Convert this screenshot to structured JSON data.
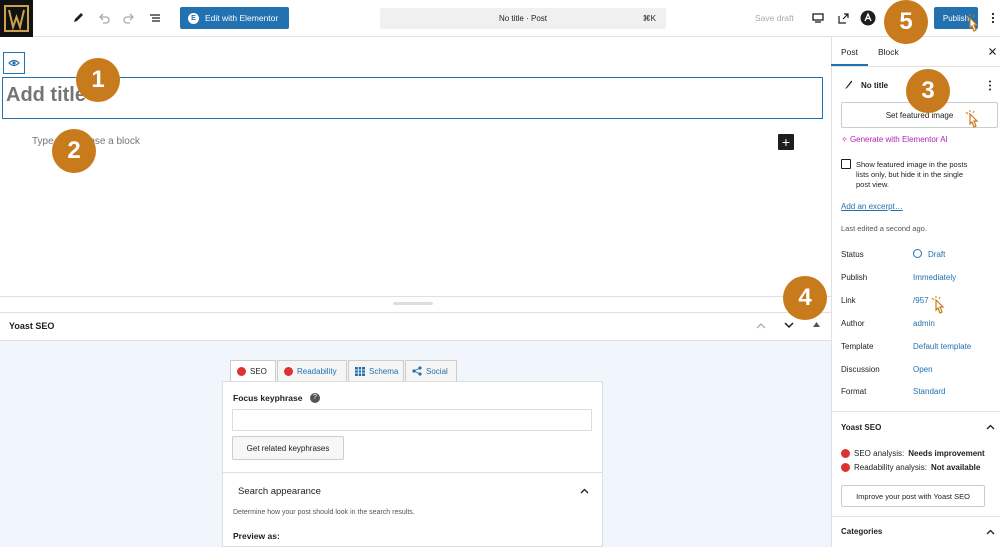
{
  "topbar": {
    "edit_elementor_label": "Edit with Elementor",
    "command_title": "No title · Post",
    "command_shortcut": "⌘K",
    "save_draft_label": "Save draft",
    "publish_label": "Publish"
  },
  "editor": {
    "title_placeholder": "Add title",
    "block_placeholder": "Type / to choose a block"
  },
  "yoast_panel": {
    "title": "Yoast SEO",
    "tabs": [
      {
        "label": "SEO"
      },
      {
        "label": "Readability"
      },
      {
        "label": "Schema"
      },
      {
        "label": "Social"
      }
    ],
    "focus_keyphrase_label": "Focus keyphrase",
    "focus_keyphrase_value": "",
    "related_button": "Get related keyphrases",
    "search_appearance_title": "Search appearance",
    "search_appearance_desc": "Determine how your post should look in the search results.",
    "preview_as_label": "Preview as:"
  },
  "sidebar": {
    "tab_post": "Post",
    "tab_block": "Block",
    "post_title": "No title",
    "featured_image_button": "Set featured image",
    "generate_ai": "Generate with Elementor AI",
    "show_featured_text": "Show featured image in the posts lists only, but hide it in the single post view.",
    "add_excerpt": "Add an excerpt…",
    "last_edited": "Last edited a second ago.",
    "meta": [
      {
        "label": "Status",
        "value": "Draft"
      },
      {
        "label": "Publish",
        "value": "Immediately"
      },
      {
        "label": "Link",
        "value": "/957"
      },
      {
        "label": "Author",
        "value": "admin"
      },
      {
        "label": "Template",
        "value": "Default template"
      },
      {
        "label": "Discussion",
        "value": "Open"
      },
      {
        "label": "Format",
        "value": "Standard"
      }
    ],
    "yoast_title": "Yoast SEO",
    "seo_analysis_label": "SEO analysis:",
    "seo_analysis_value": "Needs improvement",
    "readability_label": "Readability analysis:",
    "readability_value": "Not available",
    "improve_button": "Improve your post with Yoast SEO",
    "categories_title": "Categories"
  },
  "badges": [
    "1",
    "2",
    "3",
    "4",
    "5"
  ],
  "colors": {
    "accent": "#2271b1",
    "badge": "#c77b1c",
    "ai": "#b420b8",
    "error": "#dc3232"
  }
}
